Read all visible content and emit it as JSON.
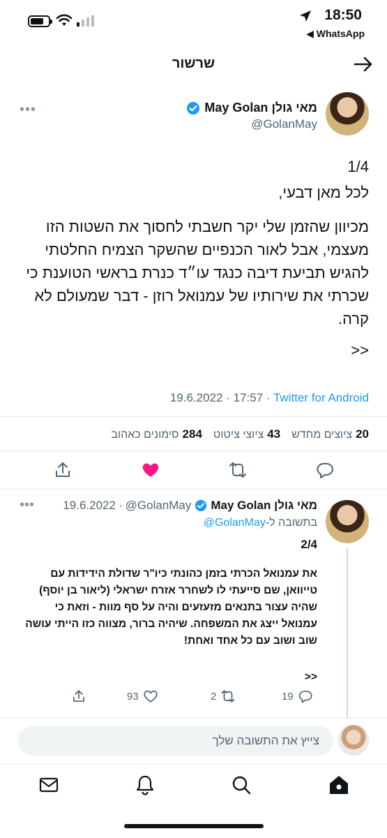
{
  "status_bar": {
    "time": "18:50",
    "back_app": "WhatsApp",
    "icons": [
      "battery-icon",
      "wifi-icon",
      "signal-icon",
      "location-arrow-icon"
    ]
  },
  "header": {
    "title": "שרשור",
    "back_icon": "arrow-right-icon"
  },
  "main_tweet": {
    "author_name": "מאי גולן May Golan",
    "handle": "@GolanMay",
    "verified": true,
    "lines": {
      "number": "1/4",
      "greeting": "לכל מאן דבעי,",
      "paragraph": "מכיוון שהזמן שלי יקר חשבתי לחסוך את השטות הזו מעצמי, אבל לאור הכנפיים שהשקר הצמיח החלטתי להגיש תביעת דיבה כנגד עו״ד כנרת בראשי הטוענת כי שכרתי את שירותיו של עמנואל רוזן - דבר שמעולם לא קרה.",
      "continuation": ">>"
    },
    "meta": {
      "date": "19.6.2022",
      "time": "17:57",
      "source": "Twitter for Android",
      "separator": "·"
    },
    "stats": {
      "retweets_count": "20",
      "retweets_label": "ציוצים מחדש",
      "quotes_count": "43",
      "quotes_label": "ציוצי ציטוט",
      "likes_count": "284",
      "likes_label": "סימונים כאהוב"
    }
  },
  "reply_tweet": {
    "author_name": "מאי גולן May Golan",
    "handle": "@GolanMay",
    "date": "19.6.2022",
    "separator": "·",
    "replying_prefix": "בתשובה ל-",
    "replying_to": "@GolanMay",
    "number": "2/4",
    "text": "את עמנואל הכרתי בזמן כהונתי כיו\"ר שדולת הידידות עם טייוואן, שם סייעתי לו לשחרר אזרח ישראלי (ליאור בן יוסף) שהיה עצור בתנאים מזעזעים והיה על סף מוות - וזאת כי עמנואל ייצג את המשפחה. שיהיה ברור, מצווה כזו הייתי עושה שוב ושוב עם כל אחד ואחת!",
    "continuation": ">>",
    "replies": "19",
    "retweets": "2",
    "likes": "93"
  },
  "compose": {
    "placeholder": "צייץ את התשובה שלך"
  },
  "colors": {
    "accent": "#1d9bf0",
    "like": "#f91880",
    "muted": "#536471"
  }
}
